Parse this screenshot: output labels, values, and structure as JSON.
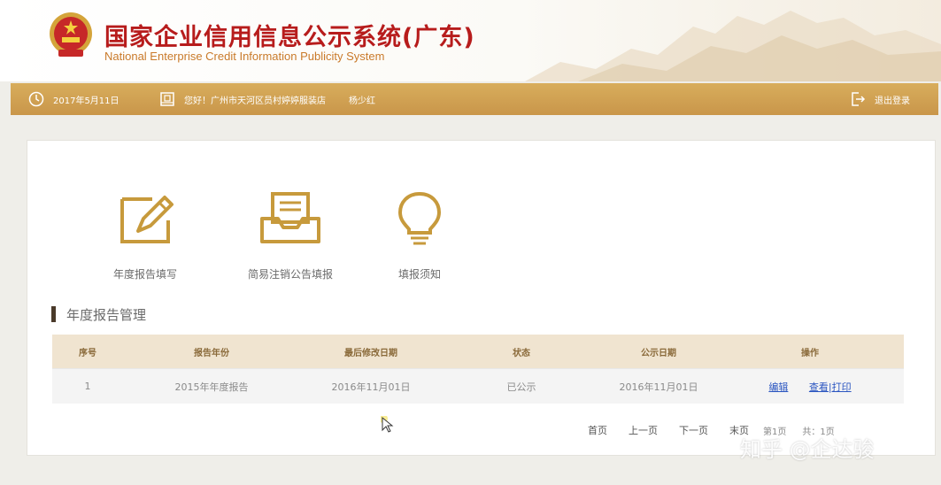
{
  "header": {
    "title": "国家企业信用信息公示系统(广东)",
    "subtitle": "National Enterprise Credit Information Publicity System"
  },
  "topbar": {
    "date": "2017年5月11日",
    "greeting": "您好！广州市天河区员村婷婷服装店",
    "user": "杨少红",
    "logout": "退出登录"
  },
  "features": [
    {
      "label": "年度报告填写",
      "icon": "edit-document-icon"
    },
    {
      "label": "简易注销公告填报",
      "icon": "inbox-tray-icon"
    },
    {
      "label": "填报须知",
      "icon": "lightbulb-icon"
    }
  ],
  "section": {
    "title": "年度报告管理"
  },
  "table": {
    "headers": [
      "序号",
      "报告年份",
      "最后修改日期",
      "状态",
      "公示日期",
      "操作"
    ],
    "rows": [
      {
        "index": "1",
        "year": "2015年年度报告",
        "modified": "2016年11月01日",
        "status": "已公示",
        "published": "2016年11月01日",
        "action_edit": "编辑",
        "action_view": "查看|打印"
      }
    ]
  },
  "pager": {
    "first": "首页",
    "prev": "上一页",
    "next": "下一页",
    "last": "末页",
    "current": "第1页",
    "total": "共：1页"
  },
  "watermark": "知乎 @企达骏",
  "colors": {
    "brand_red": "#b71c1c",
    "topbar_gold": "#cfa052",
    "icon_gold": "#c79a3c",
    "link_blue": "#2a55c0",
    "table_header": "#f0e4d0"
  }
}
